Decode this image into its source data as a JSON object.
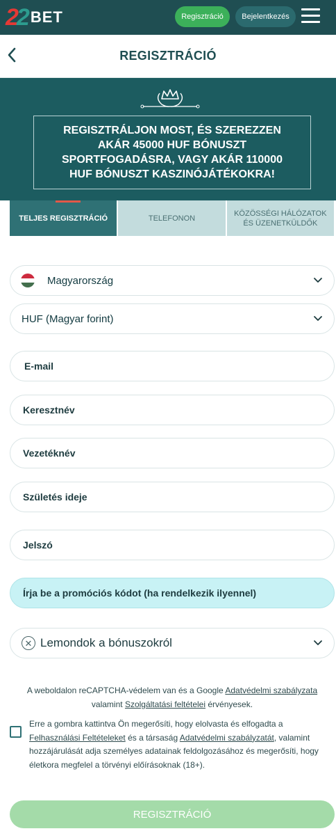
{
  "header": {
    "logo_digits": "22",
    "logo_word": "BET",
    "register_label": "Regisztráció",
    "login_label": "Bejelentkezés"
  },
  "page": {
    "title": "REGISZTRÁCIÓ"
  },
  "banner": {
    "promo_text": "REGISZTRÁLJON MOST, ÉS SZEREZZEN AKÁR 45000 HUF BÓNUSZT SPORTFOGADÁSRA, VAGY AKÁR 110000 HUF BÓNUSZT KASZINÓJÁTÉKOKRA!"
  },
  "tabs": [
    {
      "label": "TELJES REGISZTRÁCIÓ",
      "active": true
    },
    {
      "label": "TELEFONON",
      "active": false
    },
    {
      "label": "KÖZÖSSÉGI HÁLÓZATOK ÉS ÜZENETKÜLDŐK",
      "active": false
    }
  ],
  "form": {
    "country": "Magyarország",
    "currency": "HUF (Magyar forint)",
    "email": "E-mail",
    "first_name": "Keresztnév",
    "last_name": "Vezetéknév",
    "birth_date": "Születés ideje",
    "password": "Jelszó",
    "promo_code": "Írja be a promóciós kódot (ha rendelkezik ilyennel)",
    "bonus": "Lemondok a bónuszokról"
  },
  "recaptcha": {
    "text_1": "A weboldalon reCAPTCHA-védelem van és a Google ",
    "link_privacy": "Adatvédelmi szabályzata",
    "text_2": " valamint ",
    "link_terms": "Szolgáltatási feltételei",
    "text_3": " érvényesek."
  },
  "terms": {
    "text_1": "Erre a gombra kattintva Ön megerősíti, hogy elolvasta és elfogadta a ",
    "link_terms": "Felhasználási Feltételeket",
    "text_2": " és a társaság ",
    "link_privacy": "Adatvédelmi szabályzatát",
    "text_3": ", valamint hozzájárulását adja személyes adatainak feldolgozásához és megerősíti, hogy életkora megfelel a törvényi előírásoknak (18+).",
    "checked": false
  },
  "submit_label": "REGISZTRÁCIÓ",
  "colors": {
    "header_bg": "#1f4e52",
    "banner_bg": "#1c5c60",
    "accent_green": "#3cb05a",
    "active_tab": "#2f7175",
    "inactive_tab": "#c3dcdd",
    "promo_field": "#c8f2f5",
    "submit_disabled": "#a4dba9",
    "flag_red": "#cd2a3e",
    "flag_white": "#ffffff",
    "flag_green": "#436f4d"
  }
}
